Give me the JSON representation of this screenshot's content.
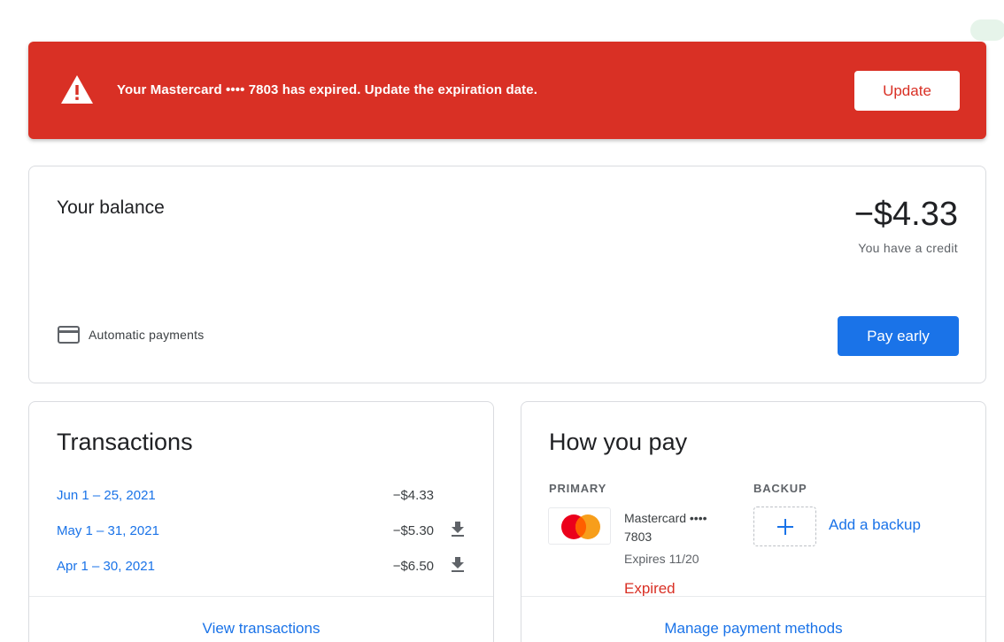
{
  "alert": {
    "message": "Your Mastercard •••• 7803 has expired. Update the expiration date.",
    "button_label": "Update",
    "icon": "warning-icon",
    "color": "#d93025"
  },
  "balance": {
    "title": "Your balance",
    "amount": "−$4.33",
    "subtitle": "You have a credit",
    "automatic_payments_label": "Automatic payments",
    "pay_early_label": "Pay early"
  },
  "transactions": {
    "title": "Transactions",
    "rows": [
      {
        "date": "Jun 1 – 25, 2021",
        "amount": "−$4.33",
        "downloadable": false
      },
      {
        "date": "May 1 – 31, 2021",
        "amount": "−$5.30",
        "downloadable": true
      },
      {
        "date": "Apr 1 – 30, 2021",
        "amount": "−$6.50",
        "downloadable": true
      }
    ],
    "footer_link": "View transactions"
  },
  "how_you_pay": {
    "title": "How you pay",
    "primary_label": "PRIMARY",
    "backup_label": "BACKUP",
    "card_name": "Mastercard ••••",
    "card_number": "7803",
    "card_expiry": "Expires 11/20",
    "card_status": "Expired",
    "add_backup_label": "Add a backup",
    "footer_link": "Manage payment methods"
  },
  "colors": {
    "accent": "#1a73e8",
    "error": "#d93025",
    "mastercard_red": "#eb001b",
    "mastercard_orange": "#f79e1b"
  }
}
